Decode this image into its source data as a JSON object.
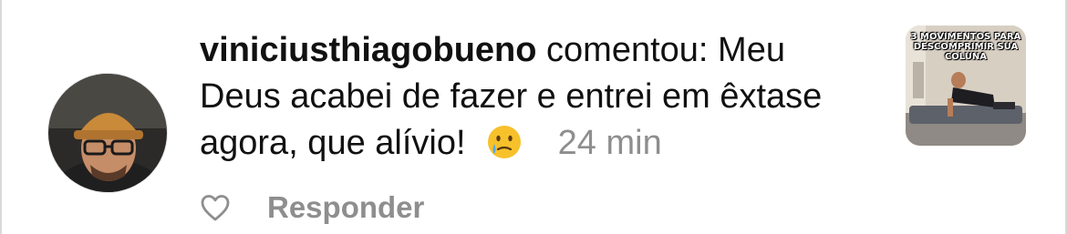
{
  "comment": {
    "username": "viniciusthiagobueno",
    "verb": "comentou:",
    "text": "Meu Deus acabei de fazer e entrei em êxtase agora, que alívio!",
    "emoji": "teary-smile-emoji",
    "time": "24 min"
  },
  "post_thumbnail": {
    "caption": "3 MOVIMENTOS PARA DESCOMPRIMIR SUA COLUNA"
  },
  "actions": {
    "like_icon": "heart-outline-icon",
    "reply_label": "Responder"
  },
  "colors": {
    "text": "#111111",
    "muted": "#8e8e8e",
    "emoji_face": "#f7c12b",
    "tear": "#52a8e8"
  }
}
